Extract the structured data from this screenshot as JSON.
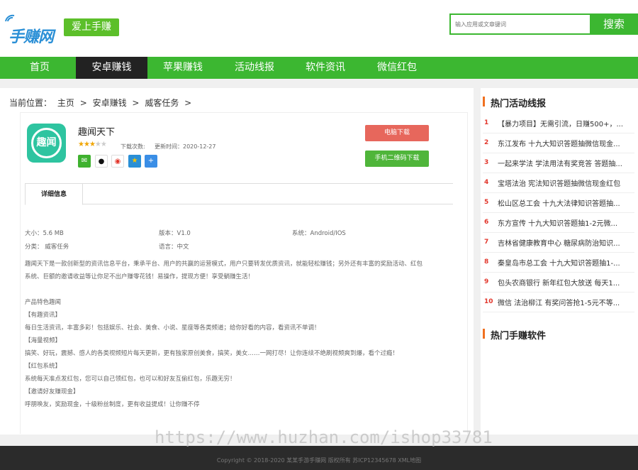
{
  "header": {
    "logo_text": "手赚网",
    "slogan": "爱上手赚",
    "search_placeholder": "输入应用或文章键词",
    "search_button": "搜索"
  },
  "nav": {
    "items": [
      "首页",
      "安卓赚钱",
      "苹果赚钱",
      "活动线报",
      "软件资讯",
      "微信红包"
    ],
    "active_index": 1
  },
  "breadcrumb": {
    "label": "当前位置：",
    "items": [
      "主页",
      ">",
      "安卓赚钱",
      ">",
      "威客任务",
      ">"
    ]
  },
  "app": {
    "icon_text": "趣闻",
    "title": "趣闻天下",
    "rating": 3,
    "rating_max": 5,
    "download_label": "下载次数:",
    "update_label": "更新时间：2020-12-27",
    "btn_pc": "电脑下载",
    "btn_qr": "手机二维码下载",
    "share_icons": [
      "wechat-icon",
      "qq-icon",
      "weibo-icon",
      "qzone-icon",
      "more-share-icon"
    ]
  },
  "tabs": {
    "active": "详细信息"
  },
  "meta": {
    "size": "大小：5.6 MB",
    "version": "版本：V1.0",
    "system": "系统：Android/IOS",
    "category": "分类：  威客任务",
    "language": "语言：中文"
  },
  "description": {
    "intro_line1": "趣闻天下是一款创新型的资讯信息平台，秉承平台、用户的共赢的运营模式，用户只要转发优质资讯，就能轻松赚钱；另外还有丰富的奖励活动、红包",
    "intro_line2": "系统、巨额的邀请收益等让你足不出户赚零花钱！易操作，提现方便！享受躺赚生活！",
    "features_title": "产品特色趣闻",
    "f1_title": "【有趣资讯】",
    "f1_text": "每日生活资讯，丰富多彩！包括娱乐、社会、美食、小说、星座等各类频道；给你好看的内容，看资讯不单调！",
    "f2_title": "【海量视频】",
    "f2_text": "搞笑、好玩，震撼、感人的各类视频短片每天更新，更有独家原创美食，搞笑，美女……一网打尽！让你连续不绝刷视频爽到爆，看个过瘾！",
    "f3_title": "【红包系统】",
    "f3_text": "系统每天准点发红包，您可以自己领红包，也可以和好友互偷红包，乐趣无穷！",
    "f4_title": "【邀请好友赚现金】",
    "f4_text": "呼朋唤友，奖励现金，十级粉丝制度，更有收益提成！让你赚不停"
  },
  "sidebar": {
    "hot_news_title": "热门活动线报",
    "hot_news": [
      {
        "num": "1",
        "text": "【暴力项目】无需引流，日赚500+，..."
      },
      {
        "num": "2",
        "text": "东江发布 十九大知识答题抽微信现金..."
      },
      {
        "num": "3",
        "text": "一起来学法 学法用法有奖竞答 答题抽..."
      },
      {
        "num": "4",
        "text": "宝塔法治 宪法知识答题抽微信现金红包"
      },
      {
        "num": "5",
        "text": "松山区总工会 十九大法律知识答题抽..."
      },
      {
        "num": "6",
        "text": "东方宣传 十九大知识答题抽1-2元微..."
      },
      {
        "num": "7",
        "text": "吉林省健康教育中心 糖尿病防治知识..."
      },
      {
        "num": "8",
        "text": "秦皇岛市总工会 十九大知识答题抽1-..."
      },
      {
        "num": "9",
        "text": "包头农商银行 新年红包大放送 每天1..."
      },
      {
        "num": "10",
        "text": "微信 法治柳江 有奖问答抢1-5元不等..."
      }
    ],
    "hot_apps_title": "热门手赚软件"
  },
  "footer": {
    "copyright": "Copyright © 2018-2020 某某手游手赚网 版权所有 苏ICP12345678 XML地图"
  },
  "watermark": "https://www.huzhan.com/ishop33781",
  "colors": {
    "brand_green": "#3cb731",
    "nav_active": "#222222",
    "btn_red": "#e7675c",
    "accent_orange": "#f07020"
  }
}
